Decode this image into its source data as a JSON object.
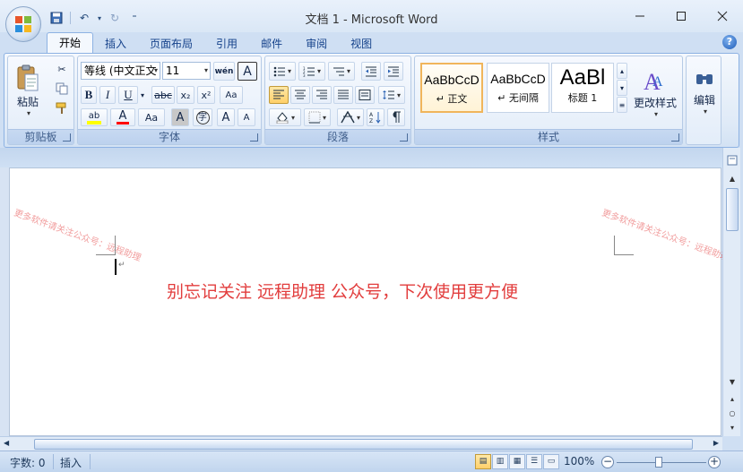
{
  "window": {
    "title": "文档 1 - Microsoft Word"
  },
  "qat": {
    "more": "⁼"
  },
  "tabs": [
    "开始",
    "插入",
    "页面布局",
    "引用",
    "邮件",
    "审阅",
    "视图"
  ],
  "help": "?",
  "groups": {
    "clipboard": {
      "label": "剪贴板",
      "paste": "粘贴"
    },
    "font": {
      "label": "字体",
      "font_name": "等线 (中文正文",
      "font_size": "11",
      "phonetic": "wén",
      "border_char": "A",
      "bold": "B",
      "italic": "I",
      "underline": "U",
      "strike": "abc",
      "sub": "x₂",
      "sup": "x²",
      "clear": "Aa",
      "grow": "A",
      "shrink": "A",
      "highlight": "ab",
      "color": "A",
      "case": "Aa",
      "shade": "A",
      "circle": "字"
    },
    "paragraph": {
      "label": "段落"
    },
    "styles": {
      "label": "样式",
      "items": [
        {
          "sample": "AaBbCcD",
          "name": "↵ 正文"
        },
        {
          "sample": "AaBbCcD",
          "name": "↵ 无间隔"
        },
        {
          "sample": "AaBl",
          "name": "标题 1"
        }
      ],
      "change": "更改样式"
    },
    "editing": {
      "label": "编辑"
    }
  },
  "document": {
    "watermark": "更多软件请关注公众号：远程助理",
    "banner": "别忘记关注 远程助理 公众号，下次使用更方便"
  },
  "status": {
    "words": "字数: 0",
    "mode": "插入",
    "zoom": "100%",
    "zoom_level": 1.0
  }
}
